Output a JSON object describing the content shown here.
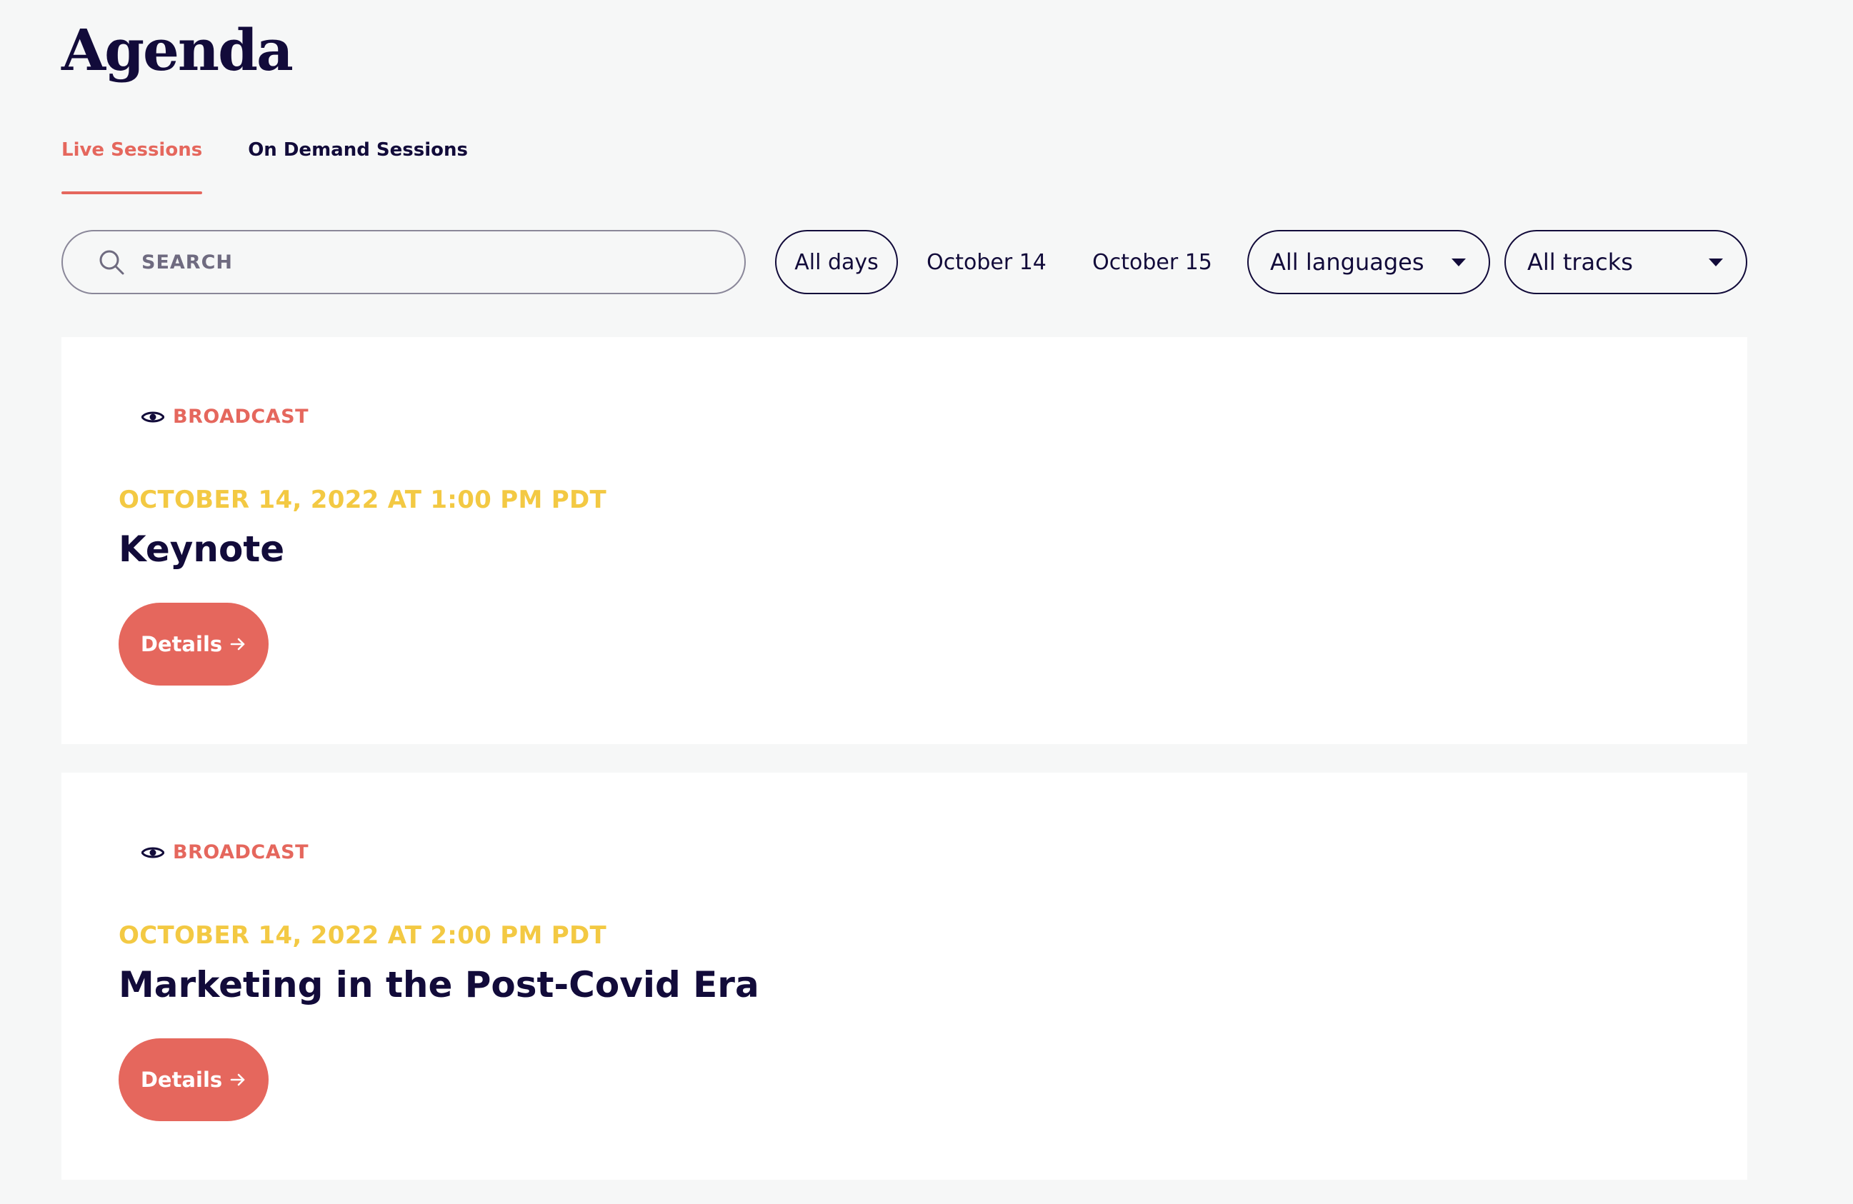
{
  "page": {
    "title": "Agenda"
  },
  "tabs": [
    {
      "label": "Live Sessions",
      "active": true
    },
    {
      "label": "On Demand Sessions",
      "active": false
    }
  ],
  "filters": {
    "search": {
      "placeholder": "SEARCH",
      "value": "",
      "icon": "search-icon"
    },
    "days": [
      {
        "label": "All days",
        "selected": true
      },
      {
        "label": "October 14",
        "selected": false
      },
      {
        "label": "October 15",
        "selected": false
      }
    ],
    "language": {
      "selected": "All languages",
      "icon": "caret-down-icon"
    },
    "tracks": {
      "selected": "All tracks",
      "icon": "caret-down-icon"
    }
  },
  "sessions": [
    {
      "badge": "BROADCAST",
      "badge_icon": "eye-icon",
      "date": "OCTOBER 14, 2022 AT 1:00 PM PDT",
      "title": "Keynote",
      "button_label": "Details"
    },
    {
      "badge": "BROADCAST",
      "badge_icon": "eye-icon",
      "date": "OCTOBER 14, 2022 AT 2:00 PM PDT",
      "title": "Marketing in the Post-Covid Era",
      "button_label": "Details"
    }
  ],
  "colors": {
    "accent": "#e5675d",
    "date": "#f3c943",
    "ink": "#120b3a",
    "background": "#f6f7f7",
    "card": "#ffffff"
  }
}
